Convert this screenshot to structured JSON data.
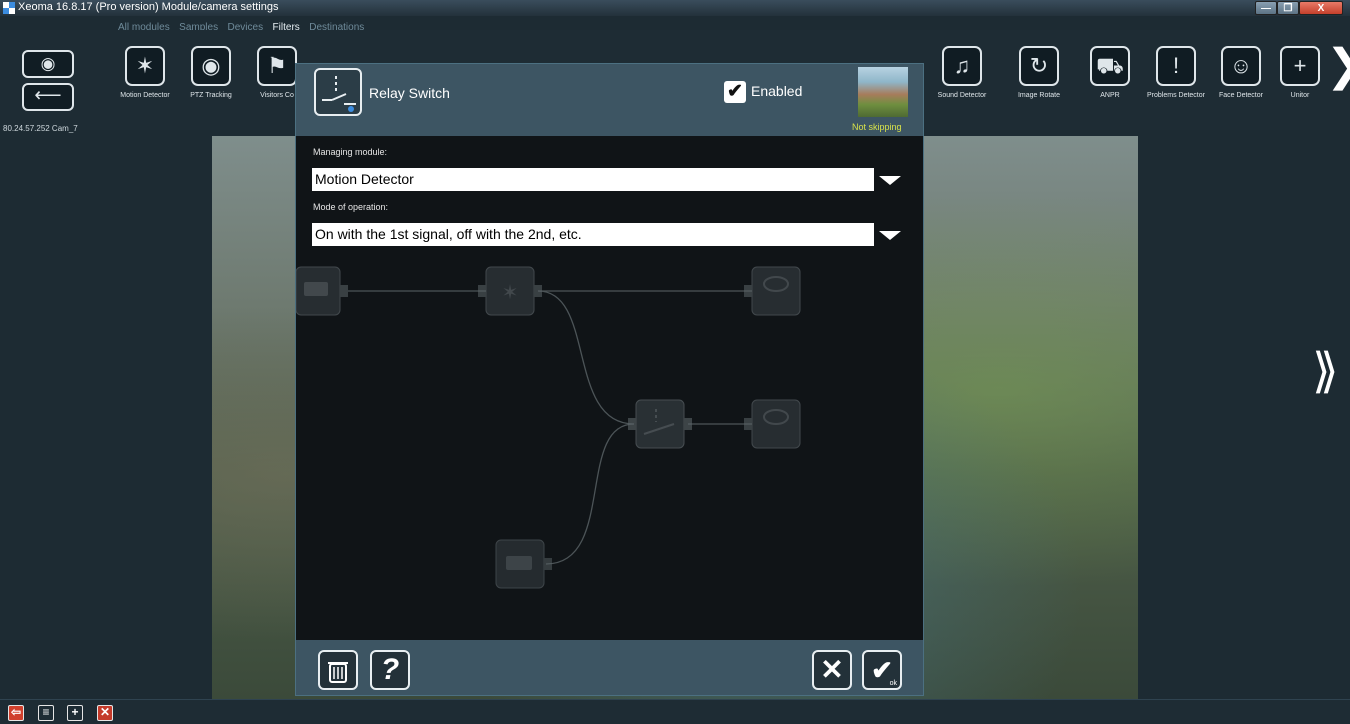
{
  "window": {
    "title": "Xeoma 16.8.17 (Pro version) Module/camera settings",
    "controls": {
      "minimize": "—",
      "maximize": "❐",
      "close": "X"
    }
  },
  "tabs": [
    {
      "label": "All modules",
      "active": false
    },
    {
      "label": "Samples",
      "active": false
    },
    {
      "label": "Devices",
      "active": false
    },
    {
      "label": "Filters",
      "active": true
    },
    {
      "label": "Destinations",
      "active": false
    }
  ],
  "toolbar": {
    "modules": [
      {
        "label": "Motion Detector",
        "icon": "motion-detector-icon",
        "glyph": "✶"
      },
      {
        "label": "PTZ Tracking",
        "icon": "ptz-tracking-icon",
        "glyph": "◉"
      },
      {
        "label": "Visitors Co",
        "icon": "visitors-counter-icon",
        "glyph": "⚑"
      },
      {
        "label": "Sound Detector",
        "icon": "sound-detector-icon",
        "glyph": "♫"
      },
      {
        "label": "Image Rotate",
        "icon": "image-rotate-icon",
        "glyph": "↻"
      },
      {
        "label": "ANPR",
        "icon": "car-icon",
        "glyph": "⛟"
      },
      {
        "label": "Problems Detector",
        "icon": "problems-detector-icon",
        "glyph": "!"
      },
      {
        "label": "Face Detector",
        "icon": "face-detector-icon",
        "glyph": "☺"
      },
      {
        "label": "Unitor",
        "icon": "unitor-icon",
        "glyph": "+"
      }
    ]
  },
  "camera_label": "80.24.57.252 Cam_7",
  "dialog": {
    "title": "Relay Switch",
    "enabled_label": "Enabled",
    "enabled": true,
    "skip_status": "Not skipping",
    "managing_module_label": "Managing module:",
    "managing_module_value": "Motion Detector",
    "mode_label": "Mode of operation:",
    "mode_value": "On with the 1st signal, off with the 2nd, etc.",
    "buttons": {
      "cancel": "✕",
      "ok": "✔",
      "ok_small": "ok",
      "help": "?"
    }
  },
  "colors": {
    "header_bg": "#3d5563",
    "dialog_bg": "#101417",
    "status_yellow": "#d9e34a",
    "close_red": "#c4402c"
  }
}
